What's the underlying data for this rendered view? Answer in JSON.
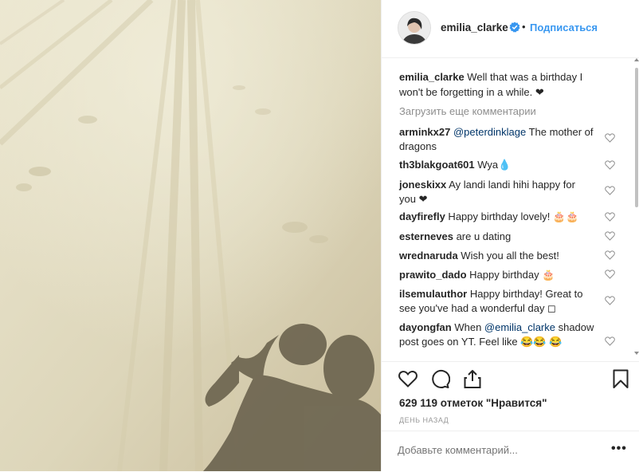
{
  "post": {
    "username": "emilia_clarke",
    "follow_label": "Подписаться",
    "dot": "•",
    "caption_user": "emilia_clarke",
    "caption_text": " Well that was a birthday I won't be forgetting in a while. ❤",
    "load_more": "Загрузить еще комментарии",
    "likes": "629 119 отметок \"Нравится\"",
    "date": "день назад",
    "add_comment_placeholder": "Добавьте комментарий...",
    "more_options": "•••"
  },
  "comments": [
    {
      "user": "arminkx27",
      "mention": "@peterdinklage",
      "text": " The mother of dragons"
    },
    {
      "user": "th3blakgoat601",
      "text": " Wya💧"
    },
    {
      "user": "joneskixx",
      "text": " Ay landi landi hihi happy for you ❤"
    },
    {
      "user": "dayfirefly",
      "text": " Happy birthday lovely! 🎂🎂"
    },
    {
      "user": "esterneves",
      "text": " are u dating"
    },
    {
      "user": "wrednaruda",
      "text": " Wish you all the best!"
    },
    {
      "user": "prawito_dado",
      "text": " Happy birthday 🎂"
    },
    {
      "user": "ilsemulauthor",
      "text": " Happy birthday! Great to see you've had a wonderful day ◻"
    },
    {
      "user": "dayongfan",
      "text_before": " When ",
      "mention": "@emilia_clarke",
      "text": " shadow post goes on YT. Feel like 😂😂 😂"
    }
  ],
  "icons": {
    "like": "heart-icon",
    "comment": "comment-icon",
    "share": "share-icon",
    "save": "bookmark-icon",
    "verified": "verified-badge-icon"
  },
  "colors": {
    "accent": "#3897f0",
    "mention": "#003569",
    "muted": "#8e8e8e"
  }
}
